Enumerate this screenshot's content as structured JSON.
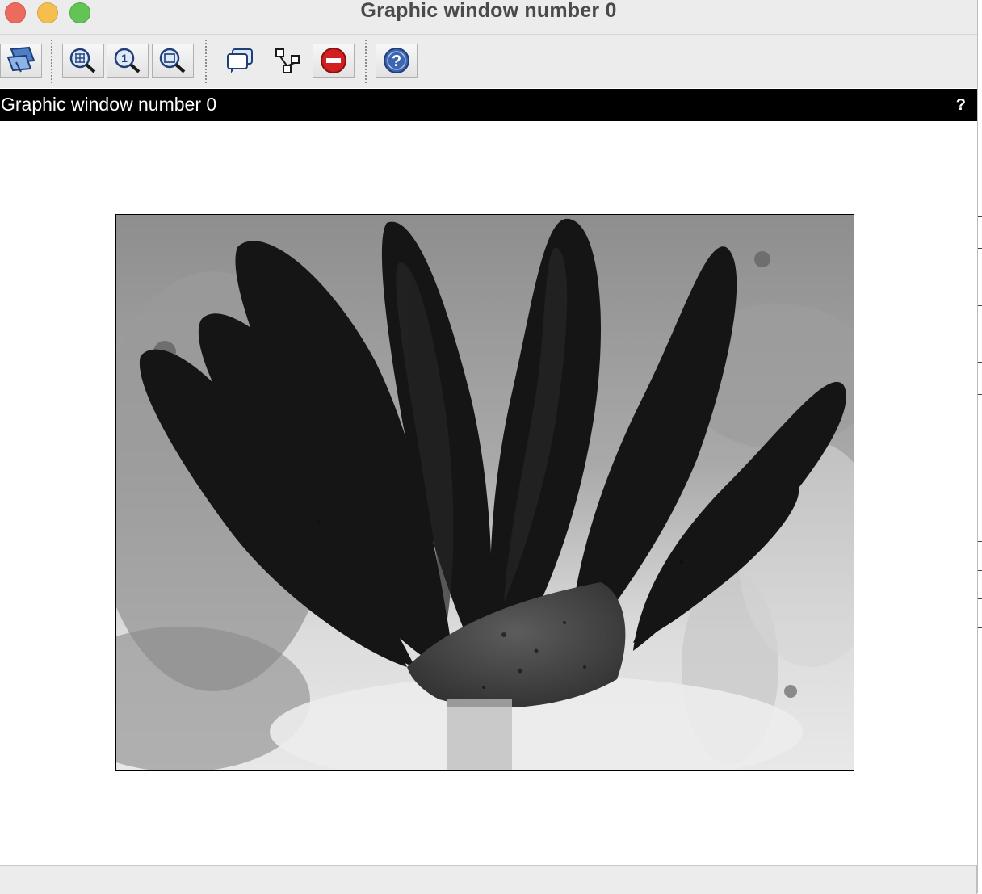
{
  "window": {
    "title": "Graphic window number 0",
    "traffic_lights": [
      "close",
      "minimize",
      "zoom"
    ]
  },
  "toolbar": {
    "buttons": [
      {
        "name": "rotate-tool",
        "icon": "rotate-icon"
      },
      {
        "name": "zoom-grid",
        "icon": "zoom-grid-icon"
      },
      {
        "name": "zoom-1to1",
        "icon": "zoom-one-icon"
      },
      {
        "name": "zoom-area",
        "icon": "zoom-area-icon"
      },
      {
        "name": "datatip",
        "icon": "datatip-icon"
      },
      {
        "name": "edit-plot",
        "icon": "plot-editor-icon"
      },
      {
        "name": "stop",
        "icon": "stop-icon"
      },
      {
        "name": "help",
        "icon": "help-icon"
      }
    ]
  },
  "figure": {
    "title": "Graphic window number 0",
    "help_glyph": "?"
  },
  "plot": {
    "content": "grayscale inverted image of a lotus flower bud",
    "colors": {
      "background": "#cfcfcf",
      "petal": "#141414",
      "bud_base": "#4a4a4a"
    }
  }
}
